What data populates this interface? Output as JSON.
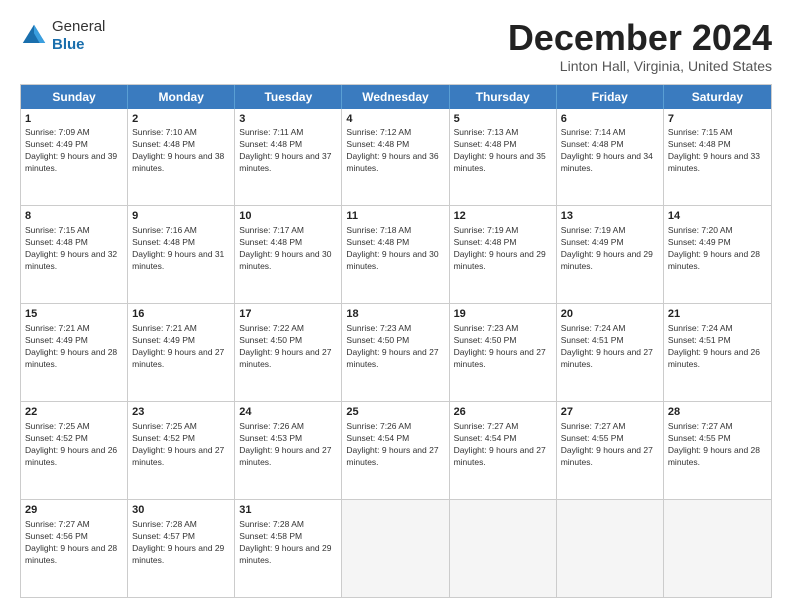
{
  "header": {
    "logo_general": "General",
    "logo_blue": "Blue",
    "month_title": "December 2024",
    "location": "Linton Hall, Virginia, United States"
  },
  "weekdays": [
    "Sunday",
    "Monday",
    "Tuesday",
    "Wednesday",
    "Thursday",
    "Friday",
    "Saturday"
  ],
  "rows": [
    [
      {
        "day": "1",
        "sunrise": "Sunrise: 7:09 AM",
        "sunset": "Sunset: 4:49 PM",
        "daylight": "Daylight: 9 hours and 39 minutes."
      },
      {
        "day": "2",
        "sunrise": "Sunrise: 7:10 AM",
        "sunset": "Sunset: 4:48 PM",
        "daylight": "Daylight: 9 hours and 38 minutes."
      },
      {
        "day": "3",
        "sunrise": "Sunrise: 7:11 AM",
        "sunset": "Sunset: 4:48 PM",
        "daylight": "Daylight: 9 hours and 37 minutes."
      },
      {
        "day": "4",
        "sunrise": "Sunrise: 7:12 AM",
        "sunset": "Sunset: 4:48 PM",
        "daylight": "Daylight: 9 hours and 36 minutes."
      },
      {
        "day": "5",
        "sunrise": "Sunrise: 7:13 AM",
        "sunset": "Sunset: 4:48 PM",
        "daylight": "Daylight: 9 hours and 35 minutes."
      },
      {
        "day": "6",
        "sunrise": "Sunrise: 7:14 AM",
        "sunset": "Sunset: 4:48 PM",
        "daylight": "Daylight: 9 hours and 34 minutes."
      },
      {
        "day": "7",
        "sunrise": "Sunrise: 7:15 AM",
        "sunset": "Sunset: 4:48 PM",
        "daylight": "Daylight: 9 hours and 33 minutes."
      }
    ],
    [
      {
        "day": "8",
        "sunrise": "Sunrise: 7:15 AM",
        "sunset": "Sunset: 4:48 PM",
        "daylight": "Daylight: 9 hours and 32 minutes."
      },
      {
        "day": "9",
        "sunrise": "Sunrise: 7:16 AM",
        "sunset": "Sunset: 4:48 PM",
        "daylight": "Daylight: 9 hours and 31 minutes."
      },
      {
        "day": "10",
        "sunrise": "Sunrise: 7:17 AM",
        "sunset": "Sunset: 4:48 PM",
        "daylight": "Daylight: 9 hours and 30 minutes."
      },
      {
        "day": "11",
        "sunrise": "Sunrise: 7:18 AM",
        "sunset": "Sunset: 4:48 PM",
        "daylight": "Daylight: 9 hours and 30 minutes."
      },
      {
        "day": "12",
        "sunrise": "Sunrise: 7:19 AM",
        "sunset": "Sunset: 4:48 PM",
        "daylight": "Daylight: 9 hours and 29 minutes."
      },
      {
        "day": "13",
        "sunrise": "Sunrise: 7:19 AM",
        "sunset": "Sunset: 4:49 PM",
        "daylight": "Daylight: 9 hours and 29 minutes."
      },
      {
        "day": "14",
        "sunrise": "Sunrise: 7:20 AM",
        "sunset": "Sunset: 4:49 PM",
        "daylight": "Daylight: 9 hours and 28 minutes."
      }
    ],
    [
      {
        "day": "15",
        "sunrise": "Sunrise: 7:21 AM",
        "sunset": "Sunset: 4:49 PM",
        "daylight": "Daylight: 9 hours and 28 minutes."
      },
      {
        "day": "16",
        "sunrise": "Sunrise: 7:21 AM",
        "sunset": "Sunset: 4:49 PM",
        "daylight": "Daylight: 9 hours and 27 minutes."
      },
      {
        "day": "17",
        "sunrise": "Sunrise: 7:22 AM",
        "sunset": "Sunset: 4:50 PM",
        "daylight": "Daylight: 9 hours and 27 minutes."
      },
      {
        "day": "18",
        "sunrise": "Sunrise: 7:23 AM",
        "sunset": "Sunset: 4:50 PM",
        "daylight": "Daylight: 9 hours and 27 minutes."
      },
      {
        "day": "19",
        "sunrise": "Sunrise: 7:23 AM",
        "sunset": "Sunset: 4:50 PM",
        "daylight": "Daylight: 9 hours and 27 minutes."
      },
      {
        "day": "20",
        "sunrise": "Sunrise: 7:24 AM",
        "sunset": "Sunset: 4:51 PM",
        "daylight": "Daylight: 9 hours and 27 minutes."
      },
      {
        "day": "21",
        "sunrise": "Sunrise: 7:24 AM",
        "sunset": "Sunset: 4:51 PM",
        "daylight": "Daylight: 9 hours and 26 minutes."
      }
    ],
    [
      {
        "day": "22",
        "sunrise": "Sunrise: 7:25 AM",
        "sunset": "Sunset: 4:52 PM",
        "daylight": "Daylight: 9 hours and 26 minutes."
      },
      {
        "day": "23",
        "sunrise": "Sunrise: 7:25 AM",
        "sunset": "Sunset: 4:52 PM",
        "daylight": "Daylight: 9 hours and 27 minutes."
      },
      {
        "day": "24",
        "sunrise": "Sunrise: 7:26 AM",
        "sunset": "Sunset: 4:53 PM",
        "daylight": "Daylight: 9 hours and 27 minutes."
      },
      {
        "day": "25",
        "sunrise": "Sunrise: 7:26 AM",
        "sunset": "Sunset: 4:54 PM",
        "daylight": "Daylight: 9 hours and 27 minutes."
      },
      {
        "day": "26",
        "sunrise": "Sunrise: 7:27 AM",
        "sunset": "Sunset: 4:54 PM",
        "daylight": "Daylight: 9 hours and 27 minutes."
      },
      {
        "day": "27",
        "sunrise": "Sunrise: 7:27 AM",
        "sunset": "Sunset: 4:55 PM",
        "daylight": "Daylight: 9 hours and 27 minutes."
      },
      {
        "day": "28",
        "sunrise": "Sunrise: 7:27 AM",
        "sunset": "Sunset: 4:55 PM",
        "daylight": "Daylight: 9 hours and 28 minutes."
      }
    ],
    [
      {
        "day": "29",
        "sunrise": "Sunrise: 7:27 AM",
        "sunset": "Sunset: 4:56 PM",
        "daylight": "Daylight: 9 hours and 28 minutes."
      },
      {
        "day": "30",
        "sunrise": "Sunrise: 7:28 AM",
        "sunset": "Sunset: 4:57 PM",
        "daylight": "Daylight: 9 hours and 29 minutes."
      },
      {
        "day": "31",
        "sunrise": "Sunrise: 7:28 AM",
        "sunset": "Sunset: 4:58 PM",
        "daylight": "Daylight: 9 hours and 29 minutes."
      },
      null,
      null,
      null,
      null
    ]
  ]
}
